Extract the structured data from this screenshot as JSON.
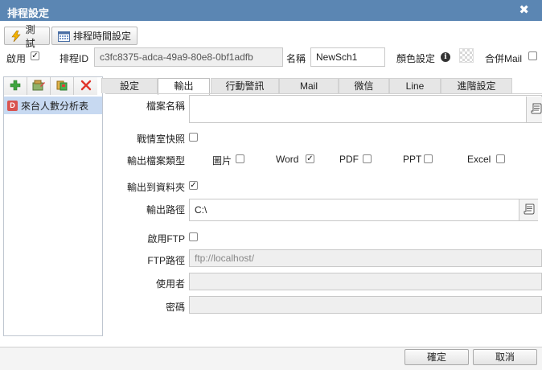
{
  "window": {
    "title": "排程設定",
    "close_glyph": "✖"
  },
  "toolbar": {
    "test_label": "測試",
    "test_icon": "lightning-icon",
    "schedule_time_label": "排程時間設定",
    "schedule_time_icon": "calendar-icon"
  },
  "header": {
    "enable_label": "啟用",
    "enable_checked": true,
    "schedule_id_label": "排程ID",
    "schedule_id_value": "c3fc8375-adca-49a9-80e8-0bf1adfb",
    "name_label": "名稱",
    "name_value": "NewSch1",
    "color_label": "顏色設定",
    "merge_mail_label": "合併Mail",
    "merge_mail_checked": false
  },
  "left_panel": {
    "tools": [
      "add-icon",
      "edit-icon",
      "copy-icon",
      "delete-icon"
    ],
    "items": [
      {
        "badge": "D",
        "label": "來台人數分析表",
        "selected": true
      }
    ]
  },
  "tabs": [
    {
      "label": "設定",
      "active": false
    },
    {
      "label": "輸出",
      "active": true
    },
    {
      "label": "行動警訊",
      "active": false
    },
    {
      "label": "Mail",
      "active": false
    },
    {
      "label": "微信",
      "active": false
    },
    {
      "label": "Line",
      "active": false
    },
    {
      "label": "進階設定",
      "active": false
    }
  ],
  "form": {
    "file_name_label": "檔案名稱",
    "file_name_value": "",
    "war_room_snapshot_label": "戰情室快照",
    "war_room_snapshot_checked": false,
    "output_type_label": "輸出檔案類型",
    "output_types": [
      {
        "label": "圖片",
        "checked": false
      },
      {
        "label": "Word",
        "checked": true
      },
      {
        "label": "PDF",
        "checked": false
      },
      {
        "label": "PPT",
        "checked": false
      },
      {
        "label": "Excel",
        "checked": false
      }
    ],
    "output_to_folder_label": "輸出到資料夾",
    "output_to_folder_checked": true,
    "output_path_label": "輸出路徑",
    "output_path_value": "C:\\",
    "enable_ftp_label": "啟用FTP",
    "enable_ftp_checked": false,
    "ftp_path_label": "FTP路徑",
    "ftp_path_placeholder": "ftp://localhost/",
    "user_label": "使用者",
    "user_value": "",
    "password_label": "密碼",
    "password_value": ""
  },
  "footer": {
    "ok_label": "確定",
    "cancel_label": "取消"
  }
}
